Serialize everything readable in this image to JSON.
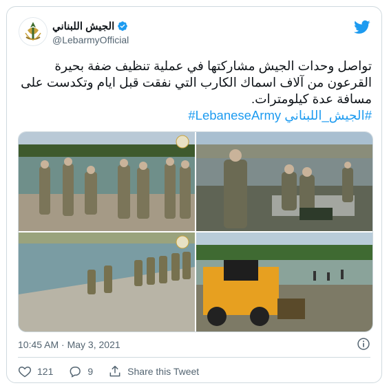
{
  "tweet": {
    "author_name": "الجيش اللبناني",
    "author_handle": "@LebarmyOfficial",
    "text": "تواصل وحدات الجيش مشاركتها في عملية تنظيف ضفة بحيرة القرعون من آلاف اسماك الكارب التي نفقت قبل ايام  وتكدست على مسافة عدة كيلومترات.",
    "hashtags": "#الجيش_اللبناني LebaneseArmy#",
    "timestamp": "10:45 AM · May 3, 2021",
    "likes": "121",
    "replies": "9",
    "share_label": "Share this Tweet"
  },
  "icons": {
    "logo": "twitter-bird-icon",
    "verified": "verified-badge-icon",
    "info": "info-icon",
    "like": "heart-icon",
    "reply": "reply-icon",
    "share": "share-icon"
  },
  "colors": {
    "accent": "#1d9bf0",
    "text": "#0f1419",
    "muted": "#536471",
    "border": "#cfd9de"
  }
}
